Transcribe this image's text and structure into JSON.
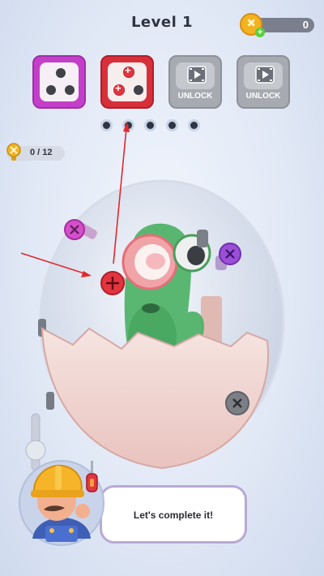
{
  "header": {
    "level_title": "Level 1",
    "coins": "0"
  },
  "toolboxes": [
    {
      "label": "",
      "state": "unlocked",
      "color": "#d751d8"
    },
    {
      "label": "",
      "state": "active",
      "color": "#e2353f"
    },
    {
      "label": "UNLOCK",
      "state": "locked",
      "color": "#b6b9bf"
    },
    {
      "label": "UNLOCK",
      "state": "locked",
      "color": "#b6b9bf"
    }
  ],
  "progress": {
    "total_steps": 5
  },
  "screws": {
    "counter": "0 / 12"
  },
  "tutorial": {
    "message": "Let's complete it!"
  },
  "colors": {
    "red_screw": "#e2353f",
    "purple_screw": "#9a4fd6",
    "magenta_screw": "#d54fc9",
    "pointer_arrow": "#e0292f"
  }
}
